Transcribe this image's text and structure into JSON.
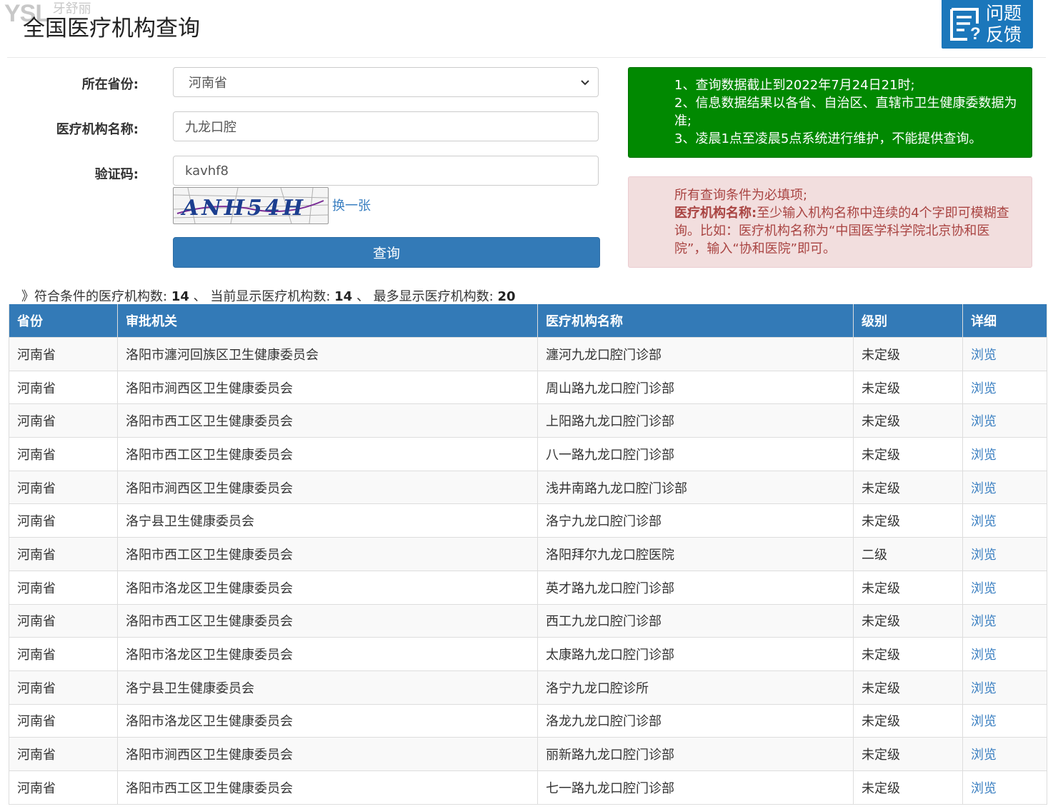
{
  "watermark": {
    "logo": "YSL",
    "text": "牙舒丽"
  },
  "header": {
    "title": "全国医疗机构查询",
    "feedback_line1": "问题",
    "feedback_line2": "反馈"
  },
  "form": {
    "province_label": "所在省份:",
    "province_value": "河南省",
    "name_label": "医疗机构名称:",
    "name_value": "九龙口腔",
    "captcha_label": "验证码:",
    "captcha_value": "kavhf8",
    "captcha_image_text": "ANH54H",
    "refresh_label": "换一张",
    "submit_label": "查询"
  },
  "notices": {
    "green": [
      "1、查询数据截止到2022年7月24日21时;",
      "2、信息数据结果以各省、自治区、直辖市卫生健康委数据为准;",
      "3、凌晨1点至凌晨5点系统进行维护，不能提供查询。"
    ],
    "pink_line1": "所有查询条件为必填项;",
    "pink_bold": "医疗机构名称:",
    "pink_rest": "至少输入机构名称中连续的4个字即可模糊查询。比如：医疗机构名称为“中国医学科学院北京协和医院”，输入“协和医院”即可。"
  },
  "summary": {
    "prefix": "》符合条件的医疗机构数:",
    "matched": "14",
    "sep1": "、 当前显示医疗机构数:",
    "shown": "14",
    "sep2": "、 最多显示医疗机构数:",
    "max": "20"
  },
  "table": {
    "headers": [
      "省份",
      "审批机关",
      "医疗机构名称",
      "级别",
      "详细"
    ],
    "rows": [
      [
        "河南省",
        "洛阳市瀍河回族区卫生健康委员会",
        "瀍河九龙口腔门诊部",
        "未定级",
        "浏览"
      ],
      [
        "河南省",
        "洛阳市涧西区卫生健康委员会",
        "周山路九龙口腔门诊部",
        "未定级",
        "浏览"
      ],
      [
        "河南省",
        "洛阳市西工区卫生健康委员会",
        "上阳路九龙口腔门诊部",
        "未定级",
        "浏览"
      ],
      [
        "河南省",
        "洛阳市西工区卫生健康委员会",
        "八一路九龙口腔门诊部",
        "未定级",
        "浏览"
      ],
      [
        "河南省",
        "洛阳市涧西区卫生健康委员会",
        "浅井南路九龙口腔门诊部",
        "未定级",
        "浏览"
      ],
      [
        "河南省",
        "洛宁县卫生健康委员会",
        "洛宁九龙口腔门诊部",
        "未定级",
        "浏览"
      ],
      [
        "河南省",
        "洛阳市西工区卫生健康委员会",
        "洛阳拜尔九龙口腔医院",
        "二级",
        "浏览"
      ],
      [
        "河南省",
        "洛阳市洛龙区卫生健康委员会",
        "英才路九龙口腔门诊部",
        "未定级",
        "浏览"
      ],
      [
        "河南省",
        "洛阳市西工区卫生健康委员会",
        "西工九龙口腔门诊部",
        "未定级",
        "浏览"
      ],
      [
        "河南省",
        "洛阳市洛龙区卫生健康委员会",
        "太康路九龙口腔门诊部",
        "未定级",
        "浏览"
      ],
      [
        "河南省",
        "洛宁县卫生健康委员会",
        "洛宁九龙口腔诊所",
        "未定级",
        "浏览"
      ],
      [
        "河南省",
        "洛阳市洛龙区卫生健康委员会",
        "洛龙九龙口腔门诊部",
        "未定级",
        "浏览"
      ],
      [
        "河南省",
        "洛阳市涧西区卫生健康委员会",
        "丽新路九龙口腔门诊部",
        "未定级",
        "浏览"
      ],
      [
        "河南省",
        "洛阳市西工区卫生健康委员会",
        "七一路九龙口腔门诊部",
        "未定级",
        "浏览"
      ]
    ]
  }
}
